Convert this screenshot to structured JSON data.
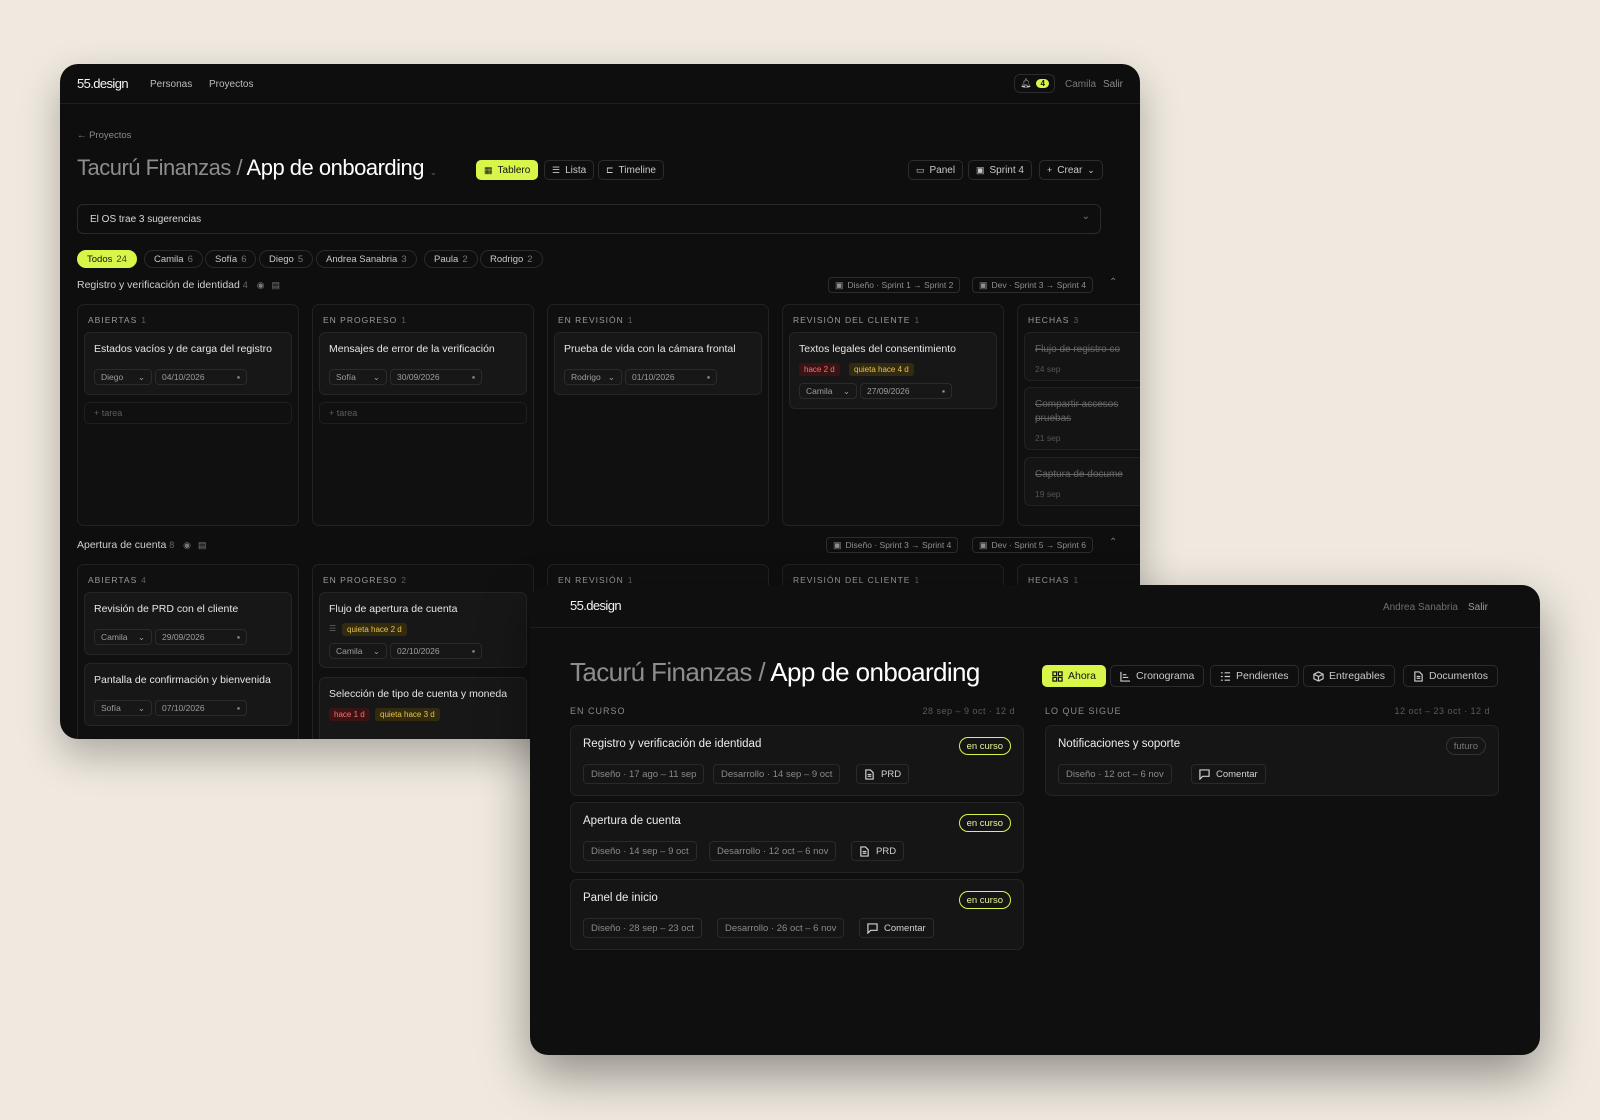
{
  "back": {
    "header": {
      "logo": "55.design",
      "nav": [
        "Personas",
        "Proyectos"
      ],
      "notif_count": "4",
      "user": "Camila",
      "logout": "Salir"
    },
    "breadcrumb": "Proyectos",
    "title": {
      "client": "Tacurú Finanzas /",
      "project": "App de onboarding"
    },
    "views": [
      "Tablero",
      "Lista",
      "Timeline"
    ],
    "actions": [
      "Panel",
      "Sprint 4",
      "Crear"
    ],
    "suggestions": "El OS trae 3 sugerencias",
    "filters": [
      {
        "label": "Todos",
        "count": "24"
      },
      {
        "label": "Camila",
        "count": "6"
      },
      {
        "label": "Sofía",
        "count": "6"
      },
      {
        "label": "Diego",
        "count": "5"
      },
      {
        "label": "Andrea Sanabria",
        "count": "3"
      },
      {
        "label": "Paula",
        "count": "2"
      },
      {
        "label": "Rodrigo",
        "count": "2"
      }
    ],
    "sections": [
      {
        "title": "Registro y verificación de identidad",
        "count": "4",
        "sprint_design": "Diseño · Sprint 1 → Sprint 2",
        "sprint_dev": "Dev · Sprint 3 → Sprint 4"
      },
      {
        "title": "Apertura de cuenta",
        "count": "8",
        "sprint_design": "Diseño · Sprint 3 → Sprint 4",
        "sprint_dev": "Dev · Sprint 5 → Sprint 6"
      }
    ],
    "columns1": [
      {
        "name": "ABIERTAS",
        "count": "1"
      },
      {
        "name": "EN PROGRESO",
        "count": "1"
      },
      {
        "name": "EN REVISIÓN",
        "count": "1"
      },
      {
        "name": "REVISIÓN DEL CLIENTE",
        "count": "1"
      },
      {
        "name": "HECHAS",
        "count": "3"
      }
    ],
    "columns2": [
      {
        "name": "ABIERTAS",
        "count": "4"
      },
      {
        "name": "EN PROGRESO",
        "count": "2"
      },
      {
        "name": "EN REVISIÓN",
        "count": "1"
      },
      {
        "name": "REVISIÓN DEL CLIENTE",
        "count": "1"
      },
      {
        "name": "HECHAS",
        "count": "1"
      }
    ],
    "cards1": [
      {
        "title": "Estados vacíos y de carga del registro",
        "assignee": "Diego",
        "date": "04/10/2026"
      },
      {
        "title": "Mensajes de error de la verificación",
        "assignee": "Sofía",
        "date": "30/09/2026"
      },
      {
        "title": "Prueba de vida con la cámara frontal",
        "assignee": "Rodrigo",
        "date": "01/10/2026"
      },
      {
        "title": "Textos legales del consentimiento",
        "tag1": "hace 2 d",
        "tag2": "quieta hace 4 d",
        "assignee": "Camila",
        "date": "27/09/2026"
      }
    ],
    "done1": [
      {
        "title": "Flujo de registro co",
        "date": "24 sep"
      },
      {
        "title": "Compartir accesos\npruebas",
        "date": "21 sep"
      },
      {
        "title": "Captura de docume",
        "date": "19 sep"
      }
    ],
    "add_task": "+ tarea",
    "cards2": [
      {
        "title": "Revisión de PRD con el cliente",
        "assignee": "Camila",
        "date": "29/09/2026"
      },
      {
        "title": "Pantalla de confirmación y bienvenida",
        "assignee": "Sofía",
        "date": "07/10/2026"
      },
      {
        "title": "Flujo de apertura de cuenta",
        "tag1": "quieta hace 2 d",
        "assignee": "Camila",
        "date": "02/10/2026"
      },
      {
        "title": "Selección de tipo de cuenta y moneda",
        "tag1": "hace 1 d",
        "tag2": "quieta hace 3 d"
      }
    ]
  },
  "front": {
    "header": {
      "logo": "55.design",
      "user": "Andrea Sanabria",
      "logout": "Salir"
    },
    "title": {
      "client": "Tacurú Finanzas /",
      "project": "App de onboarding"
    },
    "tabs": [
      "Ahora",
      "Cronograma",
      "Pendientes",
      "Entregables",
      "Documentos"
    ],
    "current": {
      "label": "EN CURSO",
      "range": "28 sep – 9 oct · 12 d"
    },
    "next": {
      "label": "LO QUE SIGUE",
      "range": "12 oct – 23 oct · 12 d"
    },
    "phases": [
      {
        "title": "Registro y verificación de identidad",
        "status": "en curso",
        "design": "Diseño · 17 ago – 11 sep",
        "dev": "Desarrollo · 14 sep – 9 oct",
        "action": "PRD"
      },
      {
        "title": "Apertura de cuenta",
        "status": "en curso",
        "design": "Diseño · 14 sep – 9 oct",
        "dev": "Desarrollo · 12 oct – 6 nov",
        "action": "PRD"
      },
      {
        "title": "Panel de inicio",
        "status": "en curso",
        "design": "Diseño · 28 sep – 23 oct",
        "dev": "Desarrollo · 26 oct – 6 nov",
        "action": "Comentar"
      }
    ],
    "next_phase": {
      "title": "Notificaciones y soporte",
      "status": "futuro",
      "design": "Diseño · 12 oct – 6 nov",
      "action": "Comentar"
    }
  },
  "colors": {
    "accent": "#d8f54a",
    "background": "#efe9df",
    "window": "#0e0e0e"
  }
}
